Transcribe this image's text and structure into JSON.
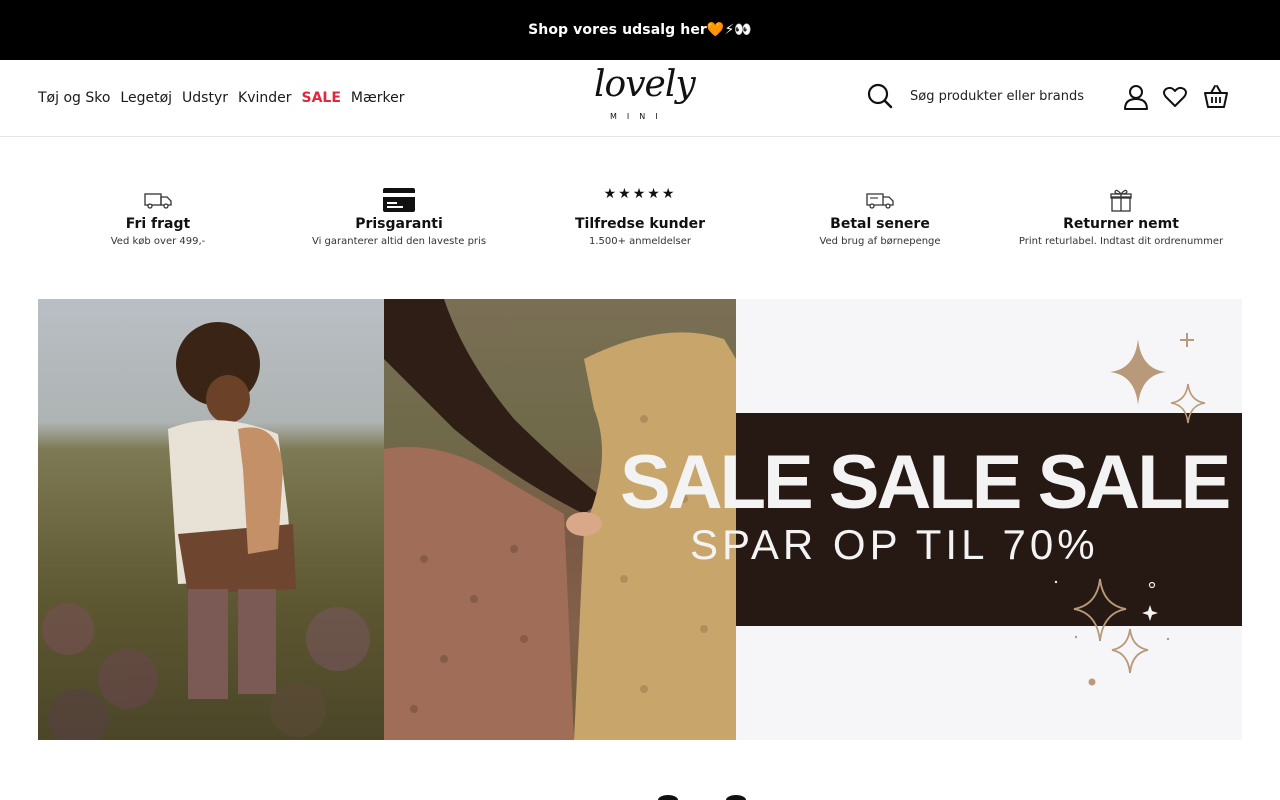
{
  "announcement": {
    "text": "Shop vores udsalg her🧡⚡👀"
  },
  "nav": {
    "items": [
      {
        "label": "Tøj og Sko"
      },
      {
        "label": "Legetøj"
      },
      {
        "label": "Udstyr"
      },
      {
        "label": "Kvinder"
      },
      {
        "label": "SALE"
      },
      {
        "label": "Mærker"
      }
    ]
  },
  "logo": {
    "script": "lovely",
    "sub": "MINI"
  },
  "search": {
    "placeholder": "Søg produkter eller brands"
  },
  "icons": {
    "search": "search-icon",
    "account": "user-icon",
    "wishlist": "heart-icon",
    "cart": "basket-icon"
  },
  "usps": [
    {
      "icon": "truck-icon",
      "title": "Fri fragt",
      "sub": "Ved køb over 499,-"
    },
    {
      "icon": "credit-card-icon",
      "title": "Prisgaranti",
      "sub": "Vi garanterer altid den laveste pris"
    },
    {
      "icon": "stars-icon",
      "title": "Tilfredse kunder",
      "sub": "1.500+ anmeldelser"
    },
    {
      "icon": "delivery-truck-icon",
      "title": "Betal senere",
      "sub": "Ved brug af børnepenge"
    },
    {
      "icon": "gift-icon",
      "title": "Returner nemt",
      "sub": "Print returlabel. Indtast dit ordrenummer"
    }
  ],
  "hero": {
    "headline": "SALE SALE SALE",
    "subline": "SPAR OP TIL 70%"
  },
  "colors": {
    "topbar": "#000000",
    "sale_link": "#e0283c",
    "band": "#261813",
    "sparkle": "#b89a7a"
  }
}
